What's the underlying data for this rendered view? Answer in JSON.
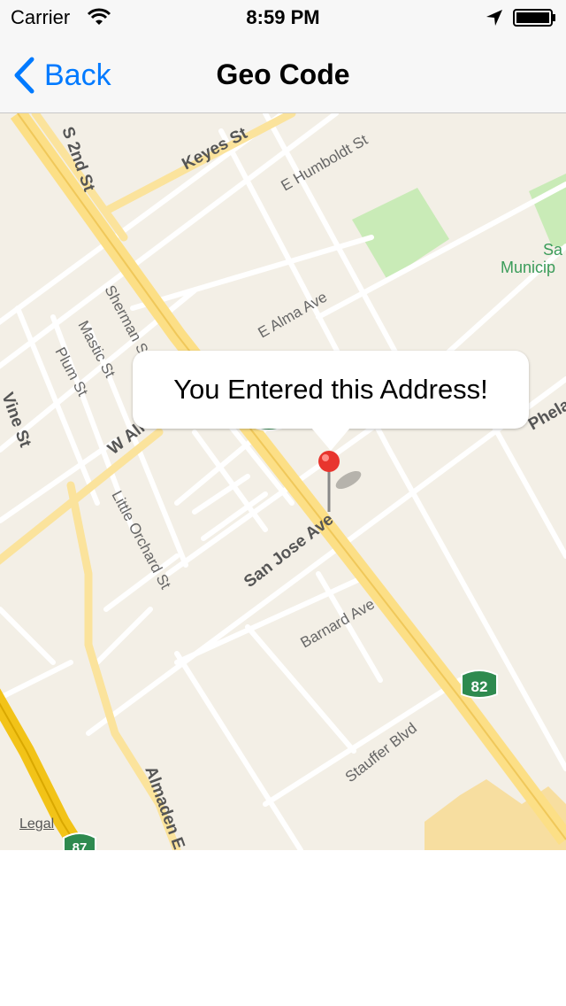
{
  "status_bar": {
    "carrier": "Carrier",
    "time": "8:59 PM"
  },
  "nav_bar": {
    "back_label": "Back",
    "title": "Geo Code"
  },
  "map": {
    "annotation_title": "You Entered this Address!",
    "legal_label": "Legal",
    "street_labels": {
      "s_2nd_st": "S 2nd St",
      "keyes_st": "Keyes St",
      "e_humboldt_st": "E Humboldt St",
      "e_alma_ave": "E Alma Ave",
      "sherman_st": "Sherman St",
      "mastic_st": "Mastic St",
      "plum_st": "Plum St",
      "vine_st": "Vine St",
      "w_alma_ave": "W Alma Ave",
      "little_orchard_st": "Little Orchard St",
      "san_jose_ave": "San Jose Ave",
      "barnard_ave": "Barnard Ave",
      "stauffer_blvd": "Stauffer Blvd",
      "almaden_expy": "Almaden E",
      "phelan_ave": "Phela",
      "municipal": "Municip",
      "municipal_top": "Sa"
    },
    "route_shields": {
      "hwy_82_a": "82",
      "hwy_82_b": "82",
      "hwy_87": "87"
    },
    "colors": {
      "land": "#f3efe6",
      "street": "#ffffff",
      "highway": "#fcdf86",
      "freeway": "#f2c318",
      "park": "#c9ebb7",
      "shield": "#2e8a4f",
      "pin": "#e8352e",
      "accent": "#007aff"
    }
  }
}
